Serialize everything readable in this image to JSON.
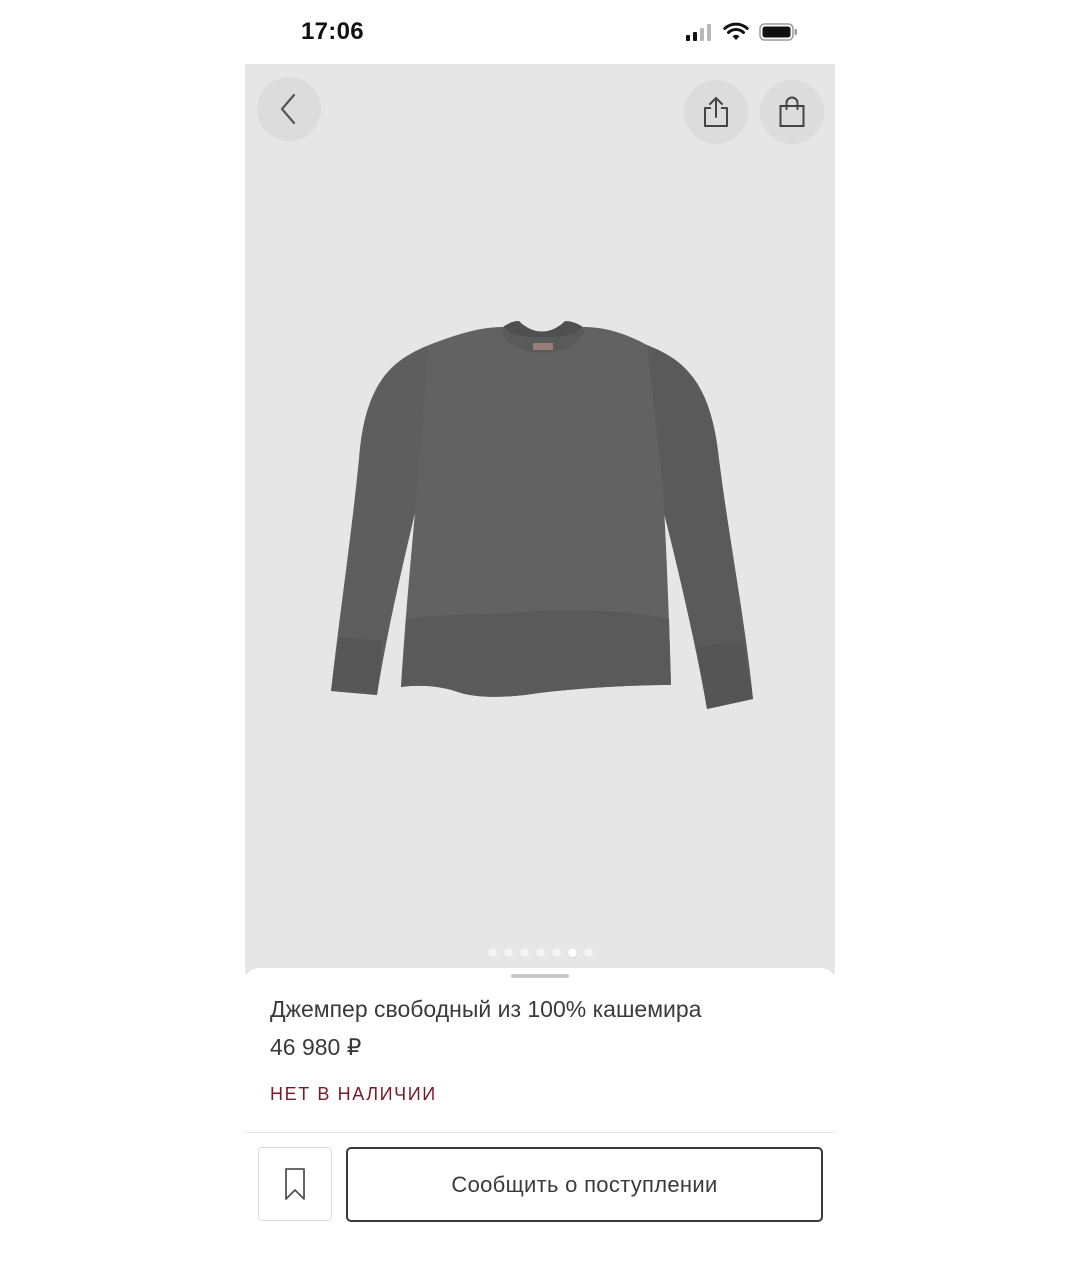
{
  "status_bar": {
    "time": "17:06"
  },
  "hero": {
    "image_icon": "sweater-image",
    "carousel": {
      "total": 7,
      "active_index": 5
    }
  },
  "product": {
    "title": "Джемпер свободный из 100% кашемира",
    "price": "46 980 ₽",
    "stock_status": "НЕТ В НАЛИЧИИ"
  },
  "actions": {
    "notify_label": "Сообщить о поступлении",
    "bookmark_icon": "bookmark-icon"
  },
  "colors": {
    "stock_status": "#7a1a26",
    "hero_background": "#e6e6e6",
    "text": "#3a3a3a"
  }
}
